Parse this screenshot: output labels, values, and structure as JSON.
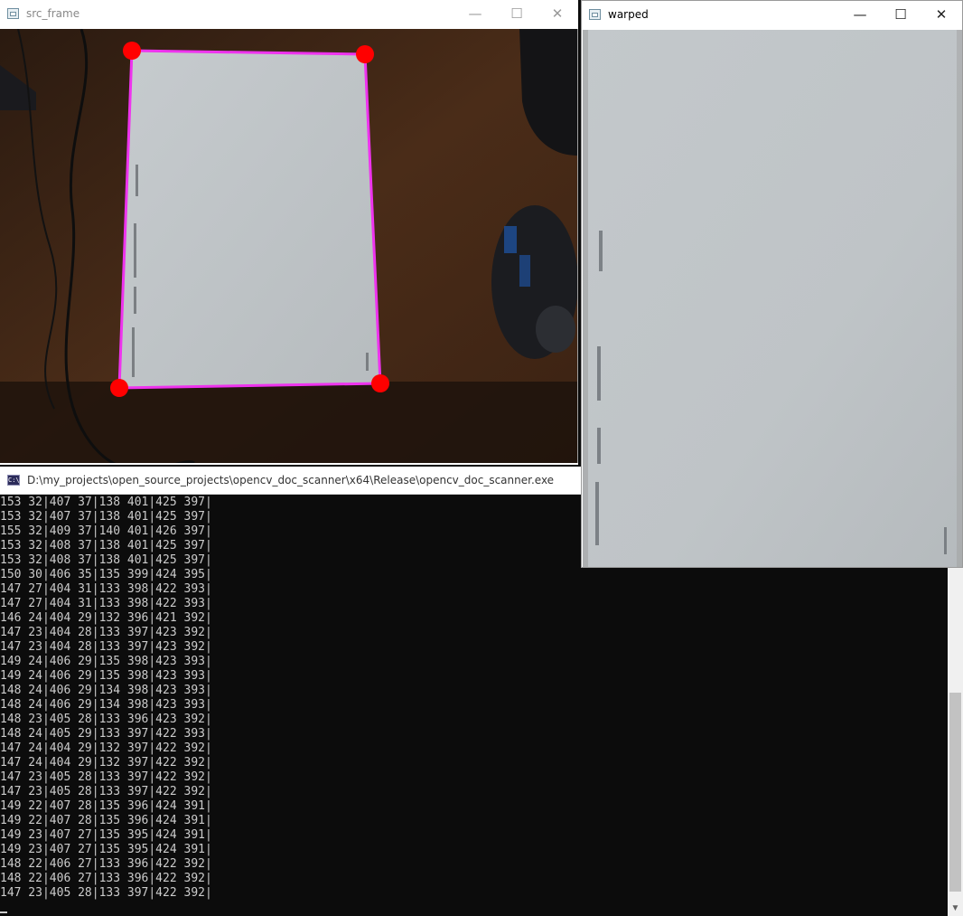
{
  "src_window": {
    "title": "src_frame",
    "controls": {
      "minimize": "—",
      "maximize": "☐",
      "close": "✕"
    }
  },
  "warped_window": {
    "title": "warped",
    "controls": {
      "minimize": "—",
      "maximize": "☐",
      "close": "✕"
    }
  },
  "console": {
    "title": "D:\\my_projects\\open_source_projects\\opencv_doc_scanner\\x64\\Release\\opencv_doc_scanner.exe",
    "icon_text": "C:\\",
    "lines": [
      "153 32|407 37|138 401|425 397|",
      "153 32|407 37|138 401|425 397|",
      "155 32|409 37|140 401|426 397|",
      "153 32|408 37|138 401|425 397|",
      "153 32|408 37|138 401|425 397|",
      "150 30|406 35|135 399|424 395|",
      "147 27|404 31|133 398|422 393|",
      "147 27|404 31|133 398|422 393|",
      "146 24|404 29|132 396|421 392|",
      "147 23|404 28|133 397|423 392|",
      "147 23|404 28|133 397|423 392|",
      "149 24|406 29|135 398|423 393|",
      "149 24|406 29|135 398|423 393|",
      "148 24|406 29|134 398|423 393|",
      "148 24|406 29|134 398|423 393|",
      "148 23|405 28|133 396|423 392|",
      "148 24|405 29|133 397|422 393|",
      "147 24|404 29|132 397|422 392|",
      "147 24|404 29|132 397|422 392|",
      "147 23|405 28|133 397|422 392|",
      "147 23|405 28|133 397|422 392|",
      "149 22|407 28|135 396|424 391|",
      "149 22|407 28|135 396|424 391|",
      "149 23|407 27|135 395|424 391|",
      "149 23|407 27|135 395|424 391|",
      "148 22|406 27|133 396|422 392|",
      "148 22|406 27|133 396|422 392|",
      "147 23|405 28|133 397|422 392|"
    ],
    "scroll_up": "▲",
    "scroll_down": "▼"
  },
  "colors": {
    "outline": "#ee33ee",
    "corner": "#ff0000",
    "paper": "#c4c9cc",
    "desk": "#3a2314",
    "console_bg": "#0c0c0c",
    "console_text": "#cccccc"
  }
}
